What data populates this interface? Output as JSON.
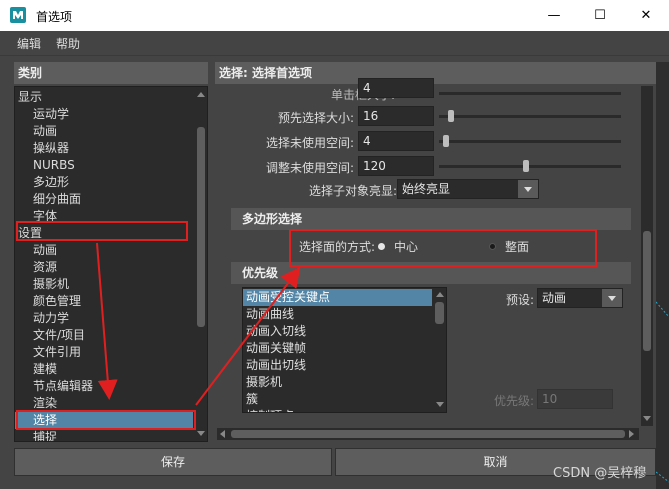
{
  "window": {
    "title": "首选项",
    "minimize": "—",
    "maximize": "☐",
    "close": "✕"
  },
  "menu": {
    "items": [
      "编辑",
      "帮助"
    ]
  },
  "left": {
    "header": "类别",
    "items": [
      "显示",
      "运动学",
      "动画",
      "操纵器",
      "NURBS",
      "多边形",
      "细分曲面",
      "字体",
      "设置",
      "动画",
      "资源",
      "摄影机",
      "颜色管理",
      "动力学",
      "文件/项目",
      "文件引用",
      "建模",
      "节点编辑器",
      "渲染",
      "选择",
      "捕捉"
    ],
    "selected_label": "选择"
  },
  "right": {
    "header": "选择: 选择首选项",
    "partial_label": "单击框大小:",
    "partial_value": "4",
    "fields": [
      {
        "label": "预先选择大小:",
        "value": "16",
        "slider": 0.05
      },
      {
        "label": "选择未使用空间:",
        "value": "4",
        "slider": 0.02
      },
      {
        "label": "调整未使用空间:",
        "value": "120",
        "slider": 0.48
      }
    ],
    "highlight": {
      "label": "选择子对象亮显:",
      "value": "始终亮显"
    },
    "poly_section": "多边形选择",
    "poly_select": {
      "label": "选择面的方式:",
      "options": [
        "中心",
        "整面"
      ],
      "selected": "中心"
    },
    "priority_section": "优先级",
    "priority_items": [
      "动画受控关键点",
      "动画曲线",
      "动画入切线",
      "动画关键帧",
      "动画出切线",
      "摄影机",
      "簇",
      "控制顶点"
    ],
    "priority_selected": "动画受控关键点",
    "preset": {
      "label": "预设:",
      "value": "动画"
    },
    "priority_field": {
      "label": "优先级:",
      "value": "10"
    }
  },
  "buttons": {
    "save": "保存",
    "cancel": "取消"
  },
  "watermark": "CSDN @吴梓穆",
  "colors": {
    "selection": "#5285a6",
    "annotation": "#e02020"
  }
}
